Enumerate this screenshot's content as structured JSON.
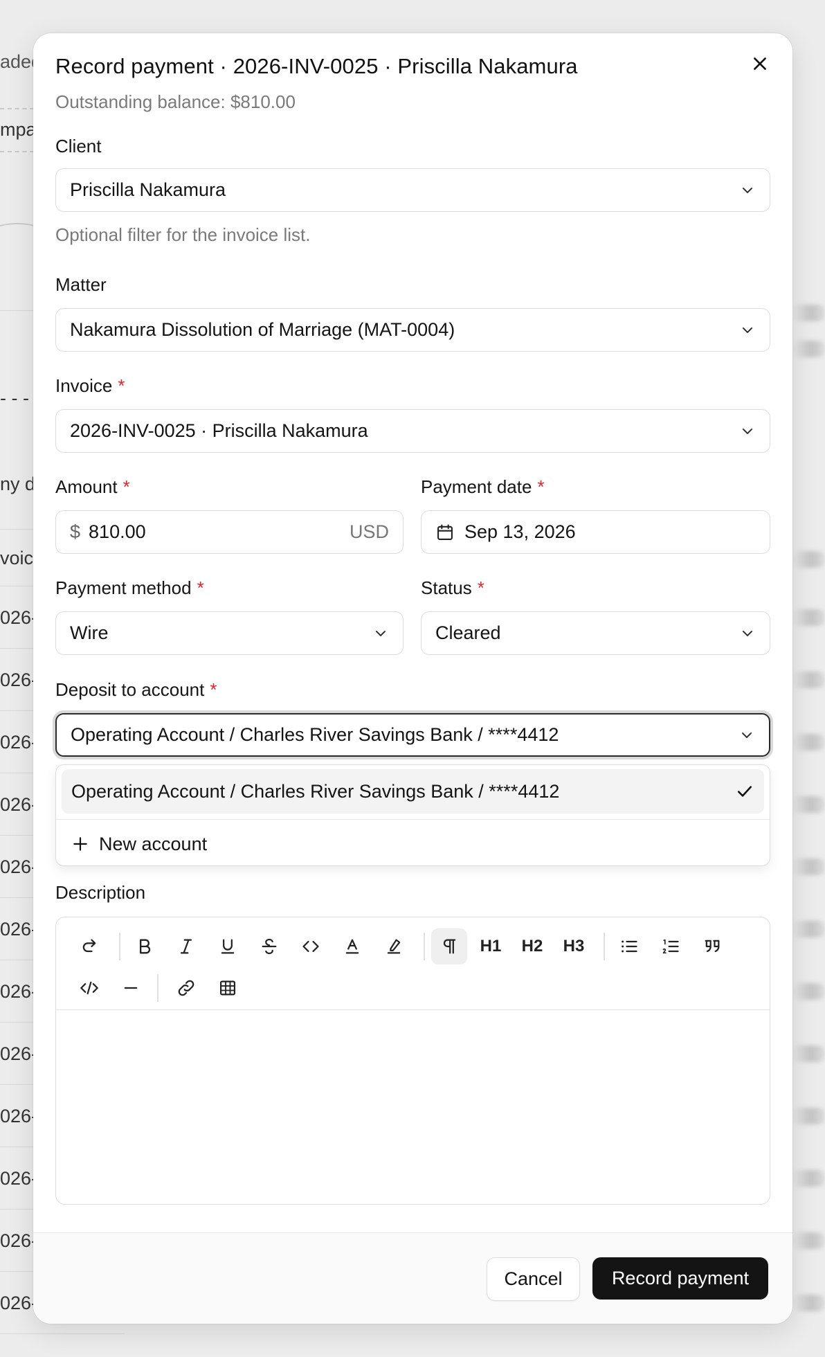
{
  "background": {
    "fragments": [
      "aded",
      "mpar",
      "- - -",
      "ny da",
      "voic",
      "026-",
      "026-",
      "026-",
      "026-",
      "026-",
      "026-",
      "026-",
      "026-",
      "026-",
      "026-",
      "026-",
      "026-"
    ]
  },
  "modal": {
    "title": "Record payment · 2026-INV-0025 · Priscilla Nakamura",
    "subtitle": "Outstanding balance: $810.00",
    "close_icon": "close-icon"
  },
  "form": {
    "client": {
      "label": "Client",
      "value": "Priscilla Nakamura",
      "hint": "Optional filter for the invoice list."
    },
    "matter": {
      "label": "Matter",
      "value": "Nakamura Dissolution of Marriage (MAT-0004)"
    },
    "invoice": {
      "label": "Invoice",
      "required": "*",
      "value": "2026-INV-0025 · Priscilla Nakamura"
    },
    "amount": {
      "label": "Amount",
      "required": "*",
      "prefix": "$",
      "value": "810.00",
      "suffix": "USD"
    },
    "payment_date": {
      "label": "Payment date",
      "required": "*",
      "value": "Sep 13, 2026",
      "icon": "calendar-icon"
    },
    "payment_method": {
      "label": "Payment method",
      "required": "*",
      "value": "Wire"
    },
    "status": {
      "label": "Status",
      "required": "*",
      "value": "Cleared"
    },
    "deposit_account": {
      "label": "Deposit to account",
      "required": "*",
      "value": "Operating Account / Charles River Savings Bank / ****4412",
      "options": [
        {
          "label": "Operating Account / Charles River Savings Bank / ****4412",
          "selected": true,
          "icon": "check-icon"
        }
      ],
      "new_account_label": "New account"
    },
    "description": {
      "label": "Description",
      "toolbar": {
        "heading_1": "H1",
        "heading_2": "H2",
        "heading_3": "H3"
      }
    }
  },
  "footer": {
    "cancel_label": "Cancel",
    "submit_label": "Record payment"
  },
  "colors": {
    "accent": "#141414",
    "required": "#e0242c",
    "muted_text": "#7a7a7a",
    "border": "#dcdcdc"
  }
}
